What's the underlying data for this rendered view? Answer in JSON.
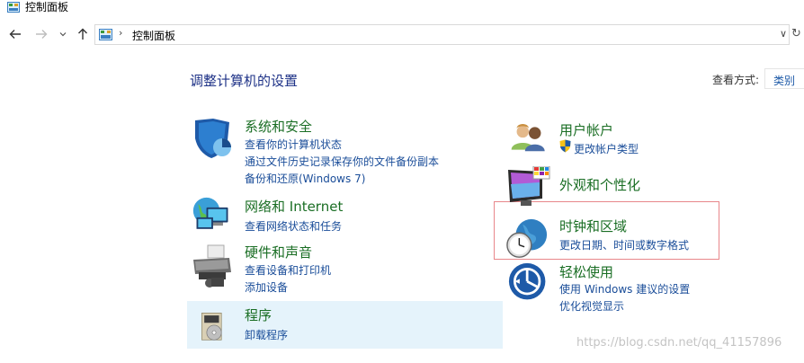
{
  "window": {
    "title": "控制面板"
  },
  "nav": {
    "back_icon": "arrow-left",
    "forward_icon": "arrow-right",
    "recent_icon": "chevron-down",
    "up_icon": "arrow-up",
    "address_path": "控制面板",
    "address_separator": "›",
    "dropdown_glyph": "∨",
    "refresh_glyph": "↻"
  },
  "main": {
    "heading": "调整计算机的设置",
    "view_by_label": "查看方式:",
    "view_by_value": "类别"
  },
  "categories": {
    "system_security": {
      "title": "系统和安全",
      "icon": "shield-icon",
      "links": [
        "查看你的计算机状态",
        "通过文件历史记录保存你的文件备份副本",
        "备份和还原(Windows 7)"
      ]
    },
    "network": {
      "title": "网络和 Internet",
      "icon": "network-globe-icon",
      "links": [
        "查看网络状态和任务"
      ]
    },
    "hardware_sound": {
      "title": "硬件和声音",
      "icon": "printer-icon",
      "links": [
        "查看设备和打印机",
        "添加设备"
      ]
    },
    "programs": {
      "title": "程序",
      "icon": "programs-disc-icon",
      "links": [
        "卸载程序"
      ]
    },
    "user_accounts": {
      "title": "用户帐户",
      "icon": "users-icon",
      "links": [
        "更改帐户类型"
      ]
    },
    "appearance": {
      "title": "外观和个性化",
      "icon": "monitor-palette-icon",
      "links": []
    },
    "clock_region": {
      "title": "时钟和区域",
      "icon": "clock-globe-icon",
      "links": [
        "更改日期、时间或数字格式"
      ]
    },
    "ease_access": {
      "title": "轻松使用",
      "icon": "ease-of-access-icon",
      "links": [
        "使用 Windows 建议的设置",
        "优化视觉显示"
      ]
    }
  },
  "watermark": "https://blog.csdn.net/qq_41157896",
  "colors": {
    "category_title": "#1a6e24",
    "link": "#1a4d99",
    "heading": "#1e3287",
    "highlight_bg": "#e5f3fb",
    "highlight_border": "#e8868a"
  }
}
